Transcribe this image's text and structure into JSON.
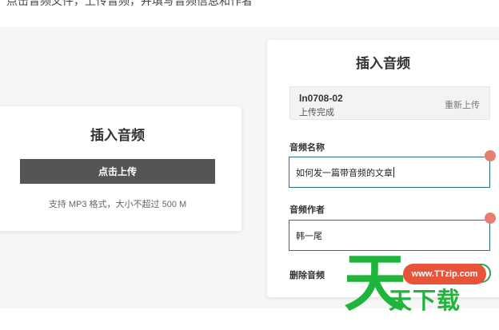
{
  "instruction_text": "点击音频文件，上传音频，并填写音频信息和作者",
  "left_card": {
    "title": "插入音频",
    "upload_button": "点击上传",
    "hint": "支持 MP3 格式，大小不超过 500 M"
  },
  "right_card": {
    "title": "插入音频",
    "file": {
      "name": "ln0708-02",
      "status": "上传完成",
      "reupload": "重新上传"
    },
    "audio_name": {
      "label": "音频名称",
      "value": "如何发一篇带音频的文章"
    },
    "audio_author": {
      "label": "音频作者",
      "value": "韩一尾"
    },
    "delete_label": "删除音频"
  },
  "watermark": {
    "badge": "www.TTzip.com",
    "big_char": "天",
    "text": "天下载"
  },
  "colors": {
    "button_dark": "#555555",
    "input_border": "#2c6f86",
    "marker": "#e67e6f",
    "toggle": "#2ea44f",
    "watermark_green": "#1fb53a",
    "watermark_red": "#e8533a"
  }
}
